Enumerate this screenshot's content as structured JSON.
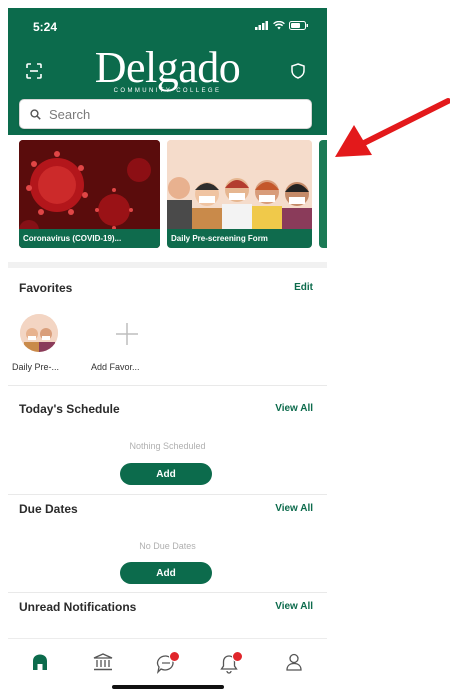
{
  "status_bar": {
    "time": "5:24"
  },
  "header": {
    "logo_main": "Delgado",
    "logo_sub": "COMMUNITY COLLEGE",
    "left_icon": "qr-scan-icon",
    "right_icon": "shield-icon",
    "color": "#0c6b4c"
  },
  "search": {
    "placeholder": "Search"
  },
  "carousel": {
    "cards": [
      {
        "label": "Coronavirus (COVID-19)..."
      },
      {
        "label": "Daily Pre-screening Form"
      }
    ]
  },
  "favorites": {
    "title": "Favorites",
    "edit_label": "Edit",
    "items": [
      {
        "label": "Daily Pre-..."
      },
      {
        "label": "Add Favor..."
      }
    ]
  },
  "schedule": {
    "title": "Today's Schedule",
    "view_all": "View All",
    "empty": "Nothing Scheduled",
    "add_label": "Add"
  },
  "due_dates": {
    "title": "Due Dates",
    "view_all": "View All",
    "empty": "No Due Dates",
    "add_label": "Add"
  },
  "notifications": {
    "title": "Unread Notifications",
    "view_all": "View All"
  },
  "tabbar": {
    "tabs": [
      "home-icon",
      "institution-icon",
      "chat-icon",
      "bell-icon",
      "profile-icon"
    ],
    "accent": "#0c6b4c",
    "badge_color": "#e0262b"
  },
  "annotation": {
    "arrow_color": "#e3191b"
  }
}
